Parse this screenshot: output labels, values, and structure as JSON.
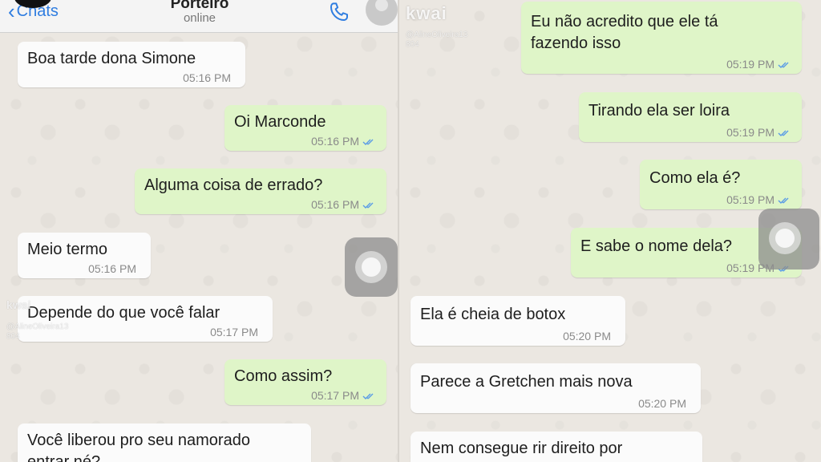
{
  "header": {
    "back_label": "Chats",
    "contact_name": "Porteiro",
    "contact_status": "online"
  },
  "watermark": {
    "logo": "kwai",
    "handle": "@AlineOliveira13",
    "code": "804"
  },
  "left_messages": [
    {
      "text": "Boa tarde dona Simone",
      "time": "05:16 PM",
      "dir": "in"
    },
    {
      "text": "Oi Marconde",
      "time": "05:16 PM",
      "dir": "out"
    },
    {
      "text": "Alguma coisa de errado?",
      "time": "05:16 PM",
      "dir": "out"
    },
    {
      "text": "Meio termo",
      "time": "05:16 PM",
      "dir": "in"
    },
    {
      "text": "Depende do que você falar",
      "time": "05:17 PM",
      "dir": "in"
    },
    {
      "text": "Como assim?",
      "time": "05:17 PM",
      "dir": "out"
    },
    {
      "line1": "Você liberou pro seu namorado",
      "line2": "entrar né?",
      "dir": "in"
    }
  ],
  "right_messages": [
    {
      "line1": "Eu não acredito que ele tá",
      "line2": "fazendo isso",
      "time": "05:19 PM",
      "dir": "out"
    },
    {
      "text": "Tirando ela ser loira",
      "time": "05:19 PM",
      "dir": "out"
    },
    {
      "text": "Como ela é?",
      "time": "05:19 PM",
      "dir": "out"
    },
    {
      "text": "E sabe o nome dela?",
      "time": "05:19 PM",
      "dir": "out"
    },
    {
      "text": "Ela é cheia de botox",
      "time": "05:20 PM",
      "dir": "in"
    },
    {
      "text": "Parece a Gretchen mais nova",
      "time": "05:20 PM",
      "dir": "in"
    },
    {
      "text": "Nem consegue rir direito por",
      "dir": "in"
    }
  ],
  "colors": {
    "incoming_bubble": "#fbfbfb",
    "outgoing_bubble": "#dff5c8",
    "accent_blue": "#2f7de0",
    "read_ticks": "#5a9be6"
  }
}
